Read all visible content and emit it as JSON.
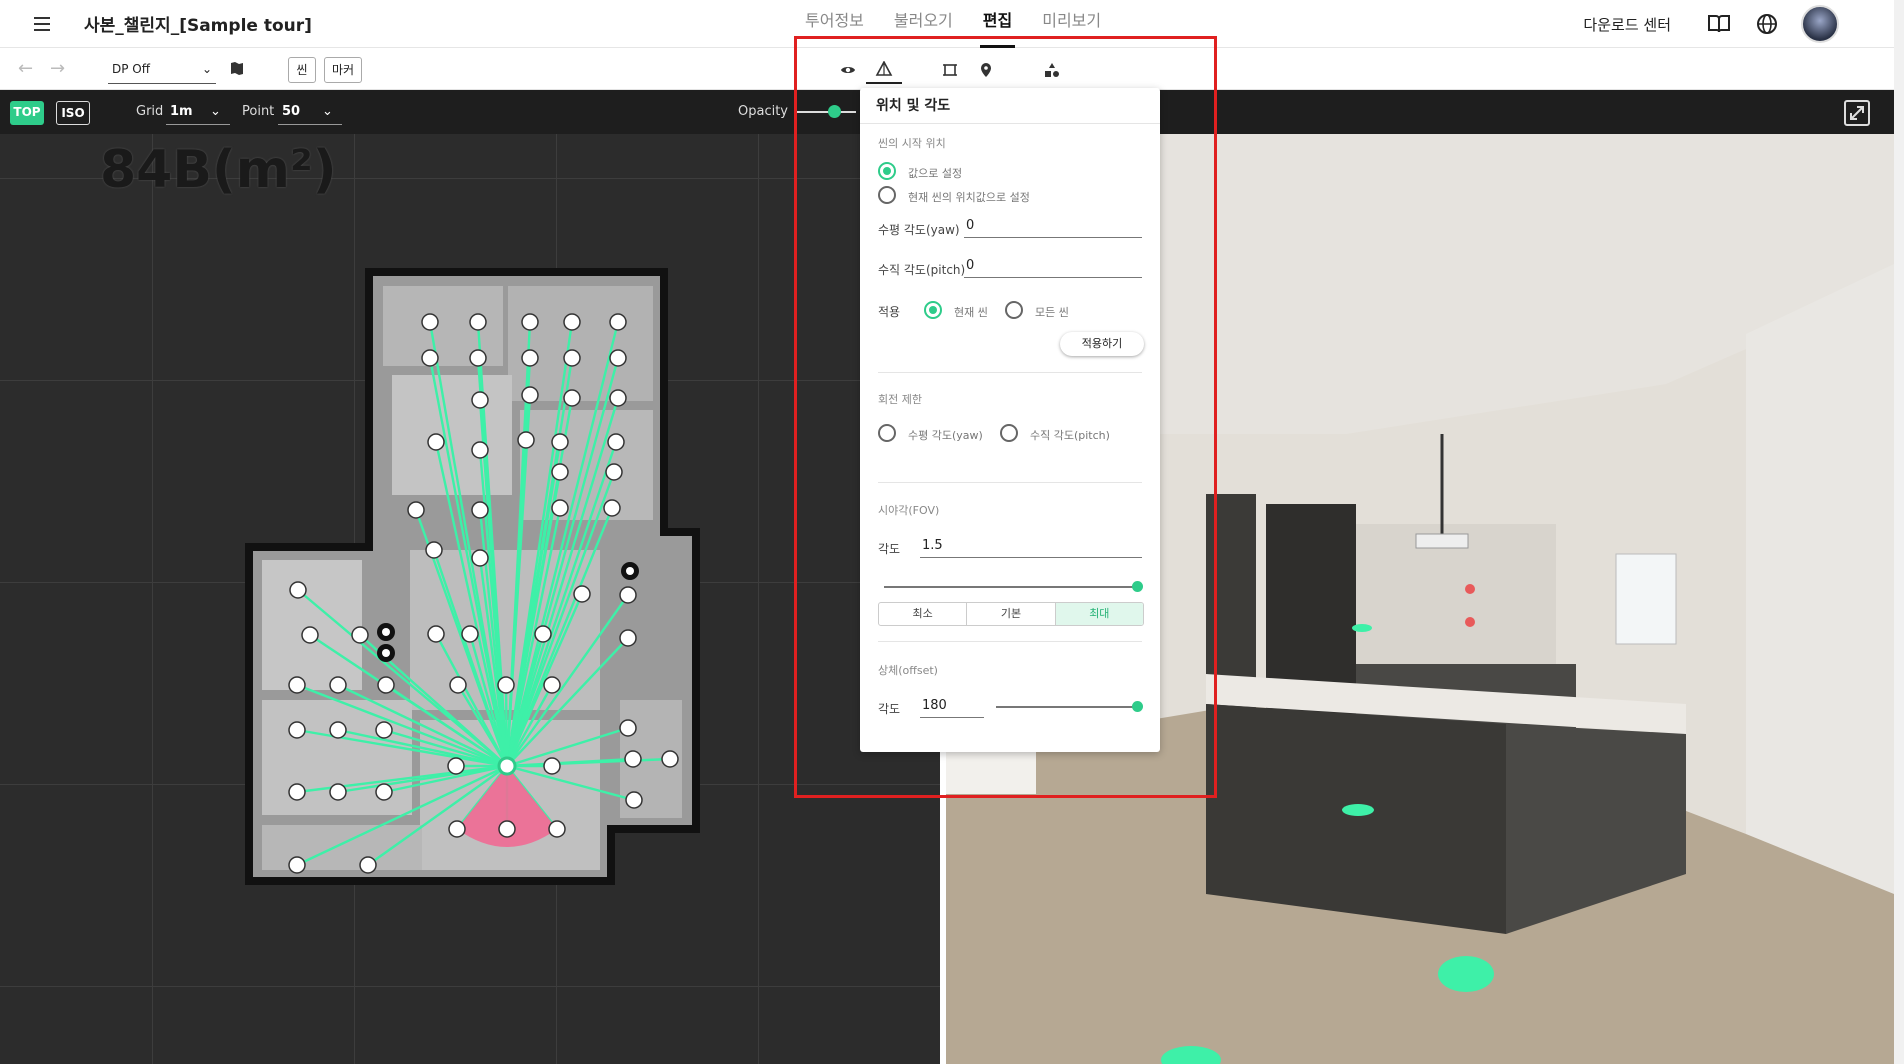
{
  "header": {
    "title": "사본_챌린지_[Sample tour]",
    "tabs": [
      {
        "label": "투어정보"
      },
      {
        "label": "불러오기"
      },
      {
        "label": "편집"
      },
      {
        "label": "미리보기"
      }
    ],
    "download_label": "다운로드 센터"
  },
  "toolbar": {
    "dp_value": "DP Off",
    "scene_label": "씬",
    "marker_label": "마커"
  },
  "map_bar": {
    "top_label": "TOP",
    "iso_label": "ISO",
    "grid_label": "Grid",
    "grid_value": "1m",
    "point_label": "Point",
    "point_value": "50",
    "opacity_label": "Opacity"
  },
  "map": {
    "area_label": "84B(m²)"
  },
  "panel": {
    "title": "위치 및 각도",
    "start_section": "씬의 시작 위치",
    "start_opt1": "값으로 설정",
    "start_opt2": "현재 씬의 위치값으로 설정",
    "yaw_label": "수평 각도(yaw)",
    "yaw_value": "0",
    "pitch_label": "수직 각도(pitch)",
    "pitch_value": "0",
    "apply_label": "적용",
    "apply_opt1": "현재 씬",
    "apply_opt2": "모든 씬",
    "apply_button": "적용하기",
    "rotation_section": "회전 제한",
    "rot_opt1": "수평 각도(yaw)",
    "rot_opt2": "수직 각도(pitch)",
    "fov_section": "시야각(FOV)",
    "fov_label": "각도",
    "fov_value": "1.5",
    "fov_level": 1.0,
    "fov_seg1": "최소",
    "fov_seg2": "기본",
    "fov_seg3": "최대",
    "offset_section": "상체(offset)",
    "offset_label": "각도",
    "offset_value": "180",
    "offset_level": 1.0
  },
  "colors": {
    "accent": "#2ecc8a",
    "highlight_box": "#e02020",
    "hotspot": "#3ef0a8",
    "camera_cone": "#f06a93"
  }
}
